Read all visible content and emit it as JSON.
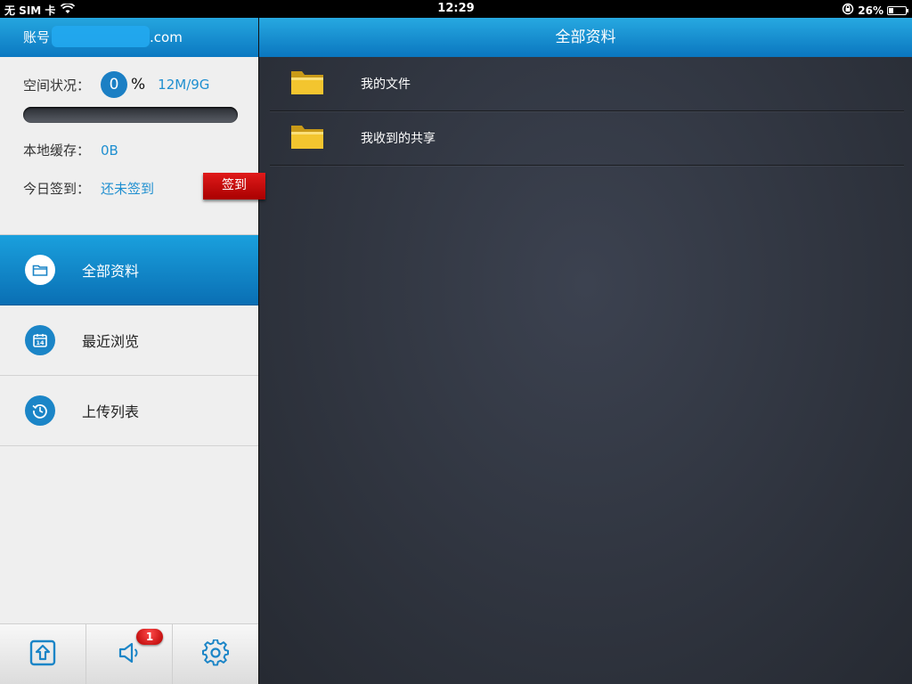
{
  "status_bar": {
    "carrier": "无 SIM 卡",
    "time": "12:29",
    "battery": "26%",
    "battery_level": 0.26
  },
  "sidebar": {
    "account_label": "账号",
    "account_suffix": ".com",
    "space_label": "空间状况：",
    "space_percent": "0",
    "percent_sign": "%",
    "space_usage": "12M/9G",
    "space_fraction": 0.0,
    "cache_label": "本地缓存：",
    "cache_value": "0B",
    "checkin_label": "今日签到：",
    "checkin_status": "还未签到",
    "checkin_button": "签到",
    "nav": [
      {
        "label": "全部资料",
        "icon": "folder-icon",
        "active": true
      },
      {
        "label": "最近浏览",
        "icon": "calendar-icon",
        "active": false
      },
      {
        "label": "上传列表",
        "icon": "history-icon",
        "active": false
      }
    ],
    "tabbar": {
      "upload_icon": "upload-icon",
      "notice_icon": "speaker-icon",
      "notice_badge": "1",
      "settings_icon": "gear-icon"
    }
  },
  "main": {
    "title": "全部资料",
    "files": [
      {
        "name": "我的文件",
        "icon": "folder-icon"
      },
      {
        "name": "我收到的共享",
        "icon": "folder-icon"
      }
    ]
  },
  "colors": {
    "accent_blue": "#1b85c7",
    "header_blue": "#0a76bf",
    "checkin_red": "#c00000",
    "main_bg": "#2c3039"
  }
}
